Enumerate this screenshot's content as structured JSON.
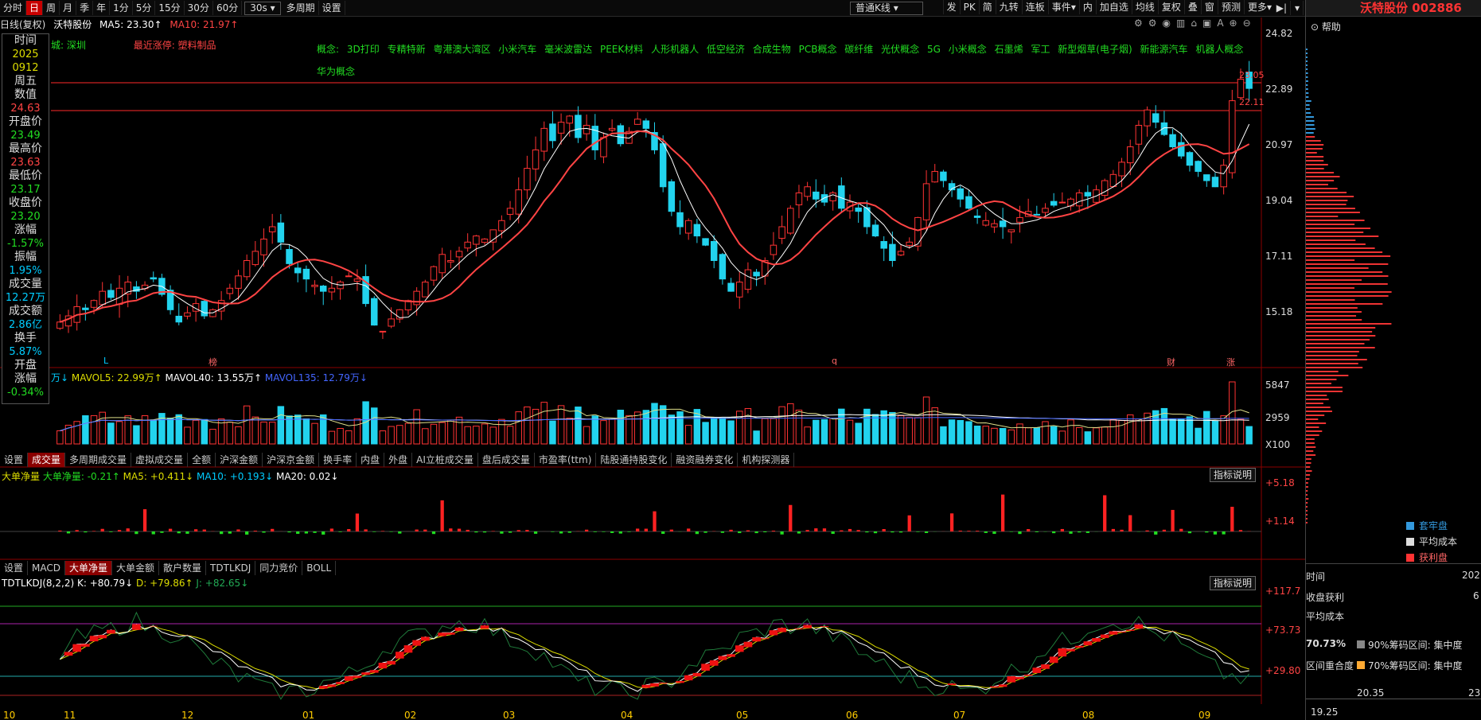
{
  "toolbar": {
    "period_label": "分时",
    "periods": [
      "日",
      "周",
      "月",
      "季",
      "年",
      "1分",
      "5分",
      "15分",
      "30分",
      "60分"
    ],
    "sub_period": "30s",
    "multi_period": "多周期",
    "settings": "设置",
    "kline_type": "普通K线",
    "right_buttons": [
      "发",
      "PK",
      "简",
      "九转",
      "连板",
      "事件",
      "内",
      "加自选",
      "均线",
      "复权",
      "叠",
      "窗",
      "预测",
      "更多"
    ]
  },
  "chart_header": {
    "mode": "日线(复权)",
    "stock_name": "沃特股份",
    "ma5": "MA5: 23.30↑",
    "ma10": "MA10: 21.97↑"
  },
  "info_row": {
    "region": "城: 深圳",
    "recent_limit": "最近涨停: 塑料制品"
  },
  "concepts": {
    "prefix": "概念:",
    "items": [
      "3D打印",
      "专精特新",
      "粤港澳大湾区",
      "小米汽车",
      "毫米波雷达",
      "PEEK材料",
      "人形机器人",
      "低空经济",
      "合成生物",
      "PCB概念",
      "碳纤维",
      "光伏概念",
      "5G",
      "小米概念",
      "石墨烯",
      "军工",
      "新型烟草(电子烟)",
      "新能源汽车",
      "机器人概念",
      "华为概念"
    ]
  },
  "sidebar": [
    {
      "label": "时间",
      "value": "2025"
    },
    {
      "label": "",
      "value": "0912"
    },
    {
      "label": "周五",
      "value": ""
    },
    {
      "label": "数值",
      "value": "24.63"
    },
    {
      "label": "开盘价",
      "value": "23.49"
    },
    {
      "label": "最高价",
      "value": "23.63"
    },
    {
      "label": "最低价",
      "value": "23.17"
    },
    {
      "label": "收盘价",
      "value": "23.20"
    },
    {
      "label": "涨幅",
      "value": "-1.57%"
    },
    {
      "label": "振幅",
      "value": "1.95%"
    },
    {
      "label": "成交量",
      "value": "12.27万"
    },
    {
      "label": "成交额",
      "value": "2.86亿"
    },
    {
      "label": "换手",
      "value": "5.87%"
    },
    {
      "label": "开盘",
      "value": ""
    },
    {
      "label": "涨幅",
      "value": "-0.34%"
    }
  ],
  "price_axis": [
    "24.82",
    "22.89",
    "20.97",
    "19.04",
    "17.11",
    "15.18"
  ],
  "price_flags": [
    "23.05",
    "22.11"
  ],
  "markers": {
    "l": "L",
    "bang": "榜",
    "q": "q",
    "cai": "财",
    "zhang": "涨"
  },
  "volume": {
    "title_lead": "万↓",
    "mavol5": "MAVOL5: 22.99万↑",
    "mavol40": "MAVOL40: 13.55万↑",
    "mavol135": "MAVOL135: 12.79万↓",
    "axis": [
      "5847",
      "2959",
      "X100"
    ]
  },
  "vol_tabs": [
    "设置",
    "成交量",
    "多周期成交量",
    "虚拟成交量",
    "全额",
    "沪深金额",
    "沪深京金额",
    "换手率",
    "内盘",
    "外盘",
    "AI立桩成交量",
    "盘后成交量",
    "市盈率(ttm)",
    "陆股通持股变化",
    "融资融券变化",
    "机构探测器"
  ],
  "net": {
    "title": "大单净量",
    "value": "大单净量: -0.21↑",
    "ma5": "MA5: +0.411↓",
    "ma10": "MA10: +0.193↓",
    "ma20": "MA20: 0.02↓",
    "axis": [
      "+5.18",
      "+1.14"
    ],
    "explain": "指标说明"
  },
  "ind_tabs": [
    "设置",
    "MACD",
    "大单净量",
    "大单金额",
    "散户数量",
    "TDTLKDJ",
    "同力竞价",
    "BOLL"
  ],
  "kdj": {
    "title": "TDTLKDJ(8,2,2)",
    "k": "K: +80.79↓",
    "d": "D: +79.86↑",
    "j": "J: +82.65↓",
    "axis": [
      "+117.7",
      "+73.73",
      "+29.80"
    ],
    "explain": "指标说明"
  },
  "months": [
    "10",
    "11",
    "12",
    "01",
    "02",
    "03",
    "04",
    "05",
    "06",
    "07",
    "08",
    "09"
  ],
  "right_panel": {
    "title": "沃特股份 002886",
    "help": "帮助",
    "legend": [
      {
        "name": "套牢盘",
        "color": "#3399dd"
      },
      {
        "name": "平均成本",
        "color": "#dddddd"
      },
      {
        "name": "获利盘",
        "color": "#ff3333"
      }
    ],
    "time_label": "时间",
    "time_value": "202",
    "profit_label": "收盘获利",
    "profit_value": "6",
    "avg_cost_label": "平均成本",
    "pct": "70.73%",
    "range90": "90%筹码区间: 集中度",
    "overlap": "区间重合度",
    "range70": "70%筹码区间: 集中度",
    "axis_bottom": [
      "20.35",
      "23"
    ],
    "axis_low": "19.25"
  },
  "chart_data": {
    "type": "candlestick",
    "price_range": [
      14.3,
      25.3
    ],
    "close": [
      15.6,
      15.8,
      16.1,
      16.0,
      16.3,
      16.6,
      16.4,
      16.7,
      16.9,
      16.6,
      16.8,
      17.0,
      16.5,
      16.0,
      15.6,
      15.9,
      16.2,
      15.8,
      16.0,
      16.3,
      16.7,
      17.1,
      17.6,
      17.9,
      18.3,
      18.7,
      18.2,
      17.5,
      17.2,
      17.0,
      16.8,
      16.6,
      16.7,
      16.9,
      17.1,
      17.0,
      16.2,
      15.5,
      15.3,
      15.7,
      16.0,
      16.3,
      16.6,
      16.9,
      17.4,
      17.8,
      17.6,
      17.9,
      18.2,
      18.4,
      18.3,
      18.6,
      18.9,
      19.3,
      19.9,
      20.6,
      21.2,
      21.9,
      21.5,
      22.1,
      22.3,
      21.6,
      22.0,
      21.2,
      21.6,
      21.9,
      21.4,
      21.8,
      22.2,
      21.9,
      21.2,
      20.0,
      19.2,
      18.7,
      18.9,
      18.4,
      18.1,
      17.6,
      17.0,
      16.6,
      16.9,
      17.3,
      17.1,
      17.6,
      18.1,
      18.7,
      19.3,
      19.8,
      20.0,
      19.6,
      19.5,
      19.8,
      19.3,
      19.5,
      19.2,
      18.7,
      18.4,
      18.0,
      17.6,
      17.9,
      18.2,
      19.0,
      20.1,
      20.5,
      20.2,
      19.9,
      19.6,
      19.3,
      19.0,
      18.9,
      18.8,
      18.7,
      18.6,
      19.0,
      19.2,
      19.1,
      19.3,
      19.4,
      19.5,
      19.6,
      19.8,
      19.7,
      19.9,
      20.2,
      20.4,
      20.8,
      21.3,
      22.0,
      22.5,
      22.1,
      21.7,
      21.3,
      21.0,
      20.7,
      20.5,
      20.2,
      20.0,
      20.7,
      22.8,
      23.5,
      23.2
    ]
  }
}
